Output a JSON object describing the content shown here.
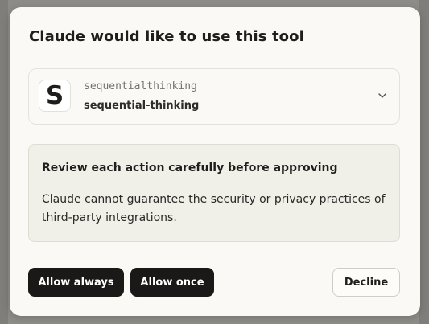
{
  "dialog": {
    "title": "Claude would like to use this tool"
  },
  "tool": {
    "logo_letter": "S",
    "server": "sequentialthinking",
    "name": "sequential-thinking",
    "expand_icon": "chevron-down-icon"
  },
  "warning": {
    "title": "Review each action carefully before approving",
    "body": "Claude cannot guarantee the security or privacy practices of third-party integrations."
  },
  "actions": {
    "allow_always": "Allow always",
    "allow_once": "Allow once",
    "decline": "Decline"
  },
  "colors": {
    "primary_button": "#1a1918",
    "dialog_background": "#faf9f5",
    "warning_background": "#f0efe8"
  }
}
